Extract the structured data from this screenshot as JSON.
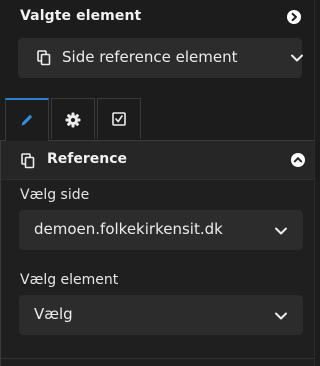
{
  "header": {
    "title": "Valgte element",
    "nav_icon": "chevron-right-circle-icon"
  },
  "element_select": {
    "icon": "copy-document-icon",
    "value": "Side reference element"
  },
  "tabs": [
    {
      "name": "edit",
      "icon": "pencil-icon",
      "active": true
    },
    {
      "name": "settings",
      "icon": "gear-icon",
      "active": false
    },
    {
      "name": "validation",
      "icon": "checkbox-icon",
      "active": false
    }
  ],
  "section": {
    "title": "Reference",
    "icon": "copy-document-icon",
    "collapse_icon": "chevron-up-circle-icon",
    "fields": [
      {
        "label": "Vælg side",
        "value": "demoen.folkekirkensit.dk"
      },
      {
        "label": "Vælg element",
        "value": "Vælg"
      }
    ]
  },
  "colors": {
    "background": "#1c1c1c",
    "input_background": "#2c2c2c",
    "active_tab_accent": "#2f7fd1",
    "text": "#ececec"
  }
}
